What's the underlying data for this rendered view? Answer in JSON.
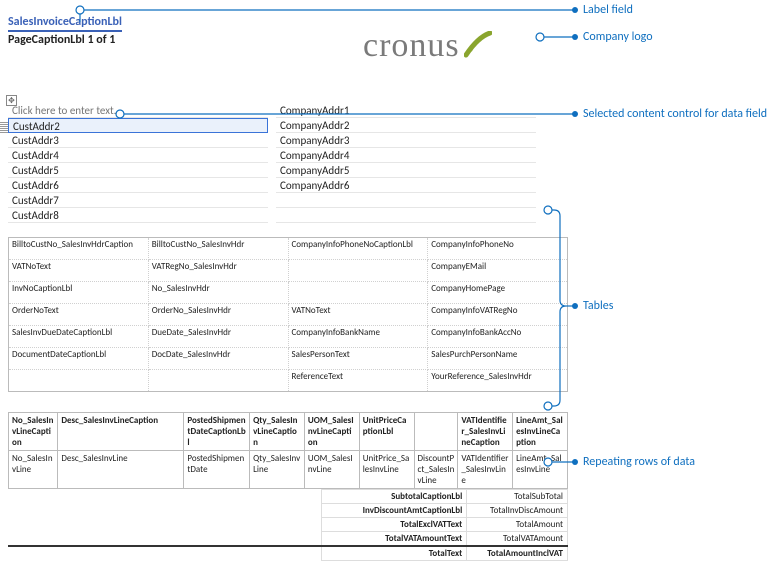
{
  "header": {
    "title": "SalesInvoiceCaptionLbl",
    "page_label": "PageCaptionLbl",
    "page_current": "1",
    "page_of": "of",
    "page_total": "1"
  },
  "logo_text": "cronus",
  "addr": {
    "left": [
      "Click here to enter text.",
      "CustAddr2",
      "CustAddr3",
      "CustAddr4",
      "CustAddr5",
      "CustAddr6",
      "CustAddr7",
      "CustAddr8"
    ],
    "right": [
      "CompanyAddr1",
      "CompanyAddr2",
      "CompanyAddr3",
      "CompanyAddr4",
      "CompanyAddr5",
      "CompanyAddr6",
      "",
      ""
    ]
  },
  "info_rows": [
    [
      "BilltoCustNo_SalesInvHdrCaption",
      "BilltoCustNo_SalesInvHdr",
      "CompanyInfoPhoneNoCaptionLbl",
      "CompanyInfoPhoneNo"
    ],
    [
      "VATNoText",
      "VATRegNo_SalesInvHdr",
      "",
      "CompanyEMail"
    ],
    [
      "InvNoCaptionLbl",
      "No_SalesInvHdr",
      "",
      "CompanyHomePage"
    ],
    [
      "OrderNoText",
      "OrderNo_SalesInvHdr",
      "VATNoText",
      "CompanyInfoVATRegNo"
    ],
    [
      "SalesInvDueDateCaptionLbl",
      "DueDate_SalesInvHdr",
      "CompanyInfoBankName",
      "CompanyInfoBankAccNo"
    ],
    [
      "DocumentDateCaptionLbl",
      "DocDate_SalesInvHdr",
      "SalesPersonText",
      "SalesPurchPersonName"
    ],
    [
      "",
      "",
      "ReferenceText",
      "YourReference_SalesInvHdr"
    ]
  ],
  "lines": {
    "headers": [
      "No_SalesInvLineCaption",
      "Desc_SalesInvLineCaption",
      "PostedShipmentDateCaptionLbl",
      "Qty_SalesInvLineCaption",
      "UOM_SalesInvLineCaption",
      "UnitPriceCaptionLbl",
      "",
      "VATIdentifier_SalesInvLineCaption",
      "LineAmt_SalesInvLineCaption"
    ],
    "row": [
      "No_SalesInvLine",
      "Desc_SalesInvLine",
      "PostedShipmentDate",
      "Qty_SalesInvLine",
      "UOM_SalesInvLine",
      "UnitPrice_SalesInvLine",
      "DiscountPct_SalesInvLine",
      "VATIdentifier_SalesInvLine",
      "LineAmt_SalesInvLine"
    ]
  },
  "totals": [
    [
      "SubtotalCaptionLbl",
      "TotalSubTotal"
    ],
    [
      "InvDiscountAmtCaptionLbl",
      "TotalInvDiscAmount"
    ],
    [
      "TotalExclVATText",
      "TotalAmount"
    ],
    [
      "TotalVATAmountText",
      "TotalVATAmount"
    ],
    [
      "TotalText",
      "TotalAmountInclVAT"
    ]
  ],
  "callouts": {
    "label_field": "Label field",
    "company_logo": "Company logo",
    "selected_cc": "Selected content control for data field",
    "tables": "Tables",
    "repeating": "Repeating rows of data"
  }
}
